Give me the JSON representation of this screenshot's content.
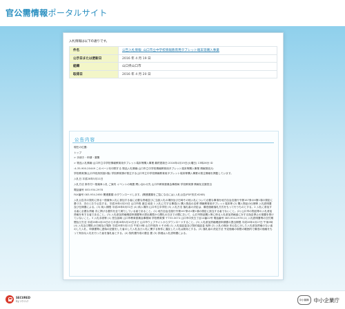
{
  "header": {
    "title_main": "官公需情報",
    "title_sub": "ポータルサイト"
  },
  "intro": "入札情報は以下の通りです。",
  "info_rows": [
    {
      "label": "件名",
      "value": "公告入札情報: 山口市立中学校情報教育用タブレット端末等購入事業",
      "link": true
    },
    {
      "label": "公示日または更新日",
      "value": "2016 年 4 月 19 日",
      "link": false
    },
    {
      "label": "組織",
      "value": "山口県山口市",
      "link": false
    },
    {
      "label": "取得日",
      "value": "2016 年 4 月 20 日",
      "link": false
    }
  ],
  "notice": {
    "title": "公告内容",
    "paragraphs": [
      "現在の位置:",
      "トップ",
      "> 手続き・申請・募集",
      "> 物品入札情報:山口市立中学校情報教育用タブレット端末等購入事業 最終更新日:2016年4月19日(火曜日) 13時26分 ID",
      ":4-35-900-20449 このページを印刷する 物品入札情報:山口市立中学校情報教育用タブレット端末等購入事業 情報発信元:",
      "学校教育課(山口市役所別館1階) 学校教育課が発注する山口市立中学校情報教育用タブレット端末等購入事業の発注情報を掲載しています。",
      "入札日 平成28年5月11日",
      "入札方法 条件付一般競争入札 ご案内 イベントの概要 問い合わせ先 山口市教育委員会事務局 学校教育課 情報化支援担当",
      "電話番号 083-934-2978",
      "FAX番号 083-934-2650 関連書類 のダウンロードします。(関連書類をご覧になるには) 入札公告(PDF形式:62KB)",
      "入札公告次の契約に係る一般競争入札に参加する者に必要な資格並びに当該入札の場所及び日時その他入札について必要な事項を地方自治法施行令第167条の6第1項の規定に基づき、次のとおり公告する。平成28年4月20日 山口市長 渡辺 純忠 1 入札に付する事項(1) 購入物品の名称 情報教育用タブレット端末等 (2) 購入物品の仕様等 入札説明書及び仕様書による。(3) 納入期限 平成28年8月31日 (4) 納入場所 山口市立中学校 (5) 入札方法 落札者の決定は、最低価格落札方式をもって行うものとする。2 入札に参加する者に必要な資格 次に掲げる要件を全て満たしている者であること。(1) 地方自治法施行令第167条の4第1項の規定に該当する者でないこと。(2) 山口市の物品等の入札参加資格を有する者であること。(3) 入札参加資格確認申請書等の提出期限から開札の日までの間において、山口市物品購入等に係る入札参加資格者に対する指名停止の措置を受けていないこと。3 入札手続等 (1) 担当部局 山口市教育委員会事務局 学校教育課 〒753-0074 山口市中央五丁目14番22号 電話番号 083-934-2978 (2) 入札説明書等の交付期間及び方法 平成28年4月20日から平成28年5月10日まで 山口市ウェブサイトからダウンロードすること。(3) 入札参加資格確認申請書の提出期限 平成28年4月27日 午後5時 (4) 入札及び開札の日時及び場所 平成28年5月11日 午前10時 山口市役所 4 その他 (1) 入札保証金及び契約保証金 免除 (2) 入札の無効 本公告に示した入札参加資格のない者のした入札、申請書等に虚偽の記載をした者のした入札及び入札に関する条件に違反した入札は無効とする。(3) 落札者の決定方法 予定価格の制限の範囲内で最低の価格をもって有効な入札を行った者を落札者とする。(4) 契約書作成の要否 要 (5) 詳細は入札説明書による。"
    ]
  },
  "footer": {
    "secured_line1": "SECURED",
    "secured_line2": "by ｼﾏﾝﾃｯｸ",
    "brand_logo_text": "中小機構",
    "brand_name": "中小企業庁"
  }
}
